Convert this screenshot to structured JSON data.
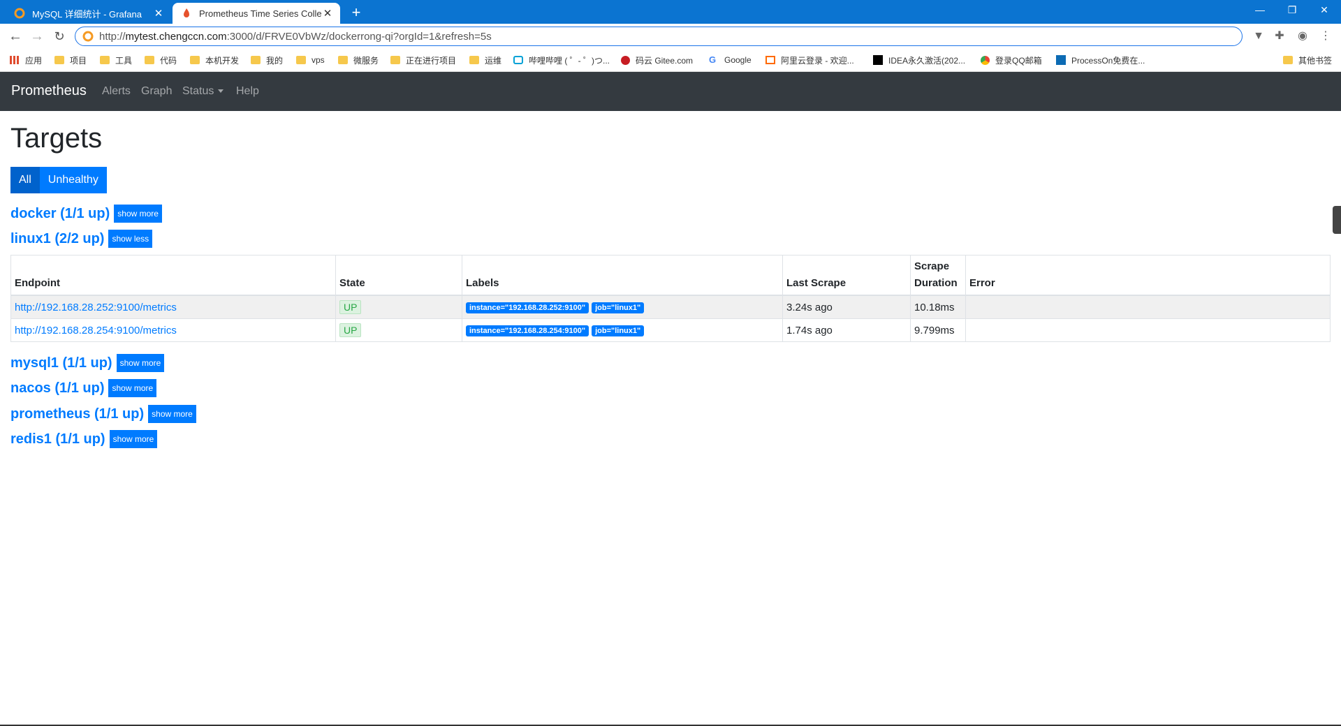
{
  "browser": {
    "tabs": [
      {
        "title": "MySQL 详细统计 - Grafana",
        "close": "✕"
      },
      {
        "title": "Prometheus Time Series Colle",
        "close": "✕"
      }
    ],
    "new_tab": "+",
    "window_controls": {
      "minimize": "—",
      "restore": "❐",
      "close": "✕"
    },
    "url_prefix": "http://",
    "url_host": "mytest.chengccn.com",
    "url_rest": ":3000/d/FRVE0VbWz/dockerrong-qi?orgId=1&refresh=5s",
    "bookmarks": [
      "应用",
      "项目",
      "工具",
      "代码",
      "本机开发",
      "我的",
      "vps",
      "微服务",
      "正在进行项目",
      "运维",
      "哔哩哔哩 ( ゜- ゜)つ...",
      "码云 Gitee.com",
      "Google",
      "阿里云登录 - 欢迎...",
      "IDEA永久激活(202...",
      "登录QQ邮箱",
      "ProcessOn免费在...",
      "其他书签"
    ]
  },
  "nav": {
    "brand": "Prometheus",
    "links": [
      "Alerts",
      "Graph",
      "Status",
      "Help"
    ]
  },
  "page": {
    "title": "Targets",
    "filters": [
      "All",
      "Unhealthy"
    ]
  },
  "pools": [
    {
      "name": "docker (1/1 up)",
      "button": "show more"
    },
    {
      "name": "linux1 (2/2 up)",
      "button": "show less"
    },
    {
      "name": "mysql1 (1/1 up)",
      "button": "show more"
    },
    {
      "name": "nacos (1/1 up)",
      "button": "show more"
    },
    {
      "name": "prometheus (1/1 up)",
      "button": "show more"
    },
    {
      "name": "redis1 (1/1 up)",
      "button": "show more"
    }
  ],
  "table": {
    "headers": {
      "endpoint": "Endpoint",
      "state": "State",
      "labels": "Labels",
      "last_scrape": "Last Scrape",
      "scrape_duration": "Scrape Duration",
      "error": "Error"
    },
    "rows": [
      {
        "endpoint": "http://192.168.28.252:9100/metrics",
        "state": "UP",
        "instance": "instance=\"192.168.28.252:9100\"",
        "job": "job=\"linux1\"",
        "last_scrape": "3.24s ago",
        "duration": "10.18ms",
        "error": ""
      },
      {
        "endpoint": "http://192.168.28.254:9100/metrics",
        "state": "UP",
        "instance": "instance=\"192.168.28.254:9100\"",
        "job": "job=\"linux1\"",
        "last_scrape": "1.74s ago",
        "duration": "9.799ms",
        "error": ""
      }
    ]
  },
  "colors": {
    "primary": "#007bff",
    "navbar": "#343a40",
    "up_green": "#28a745",
    "chrome_blue": "#0b74d1"
  }
}
